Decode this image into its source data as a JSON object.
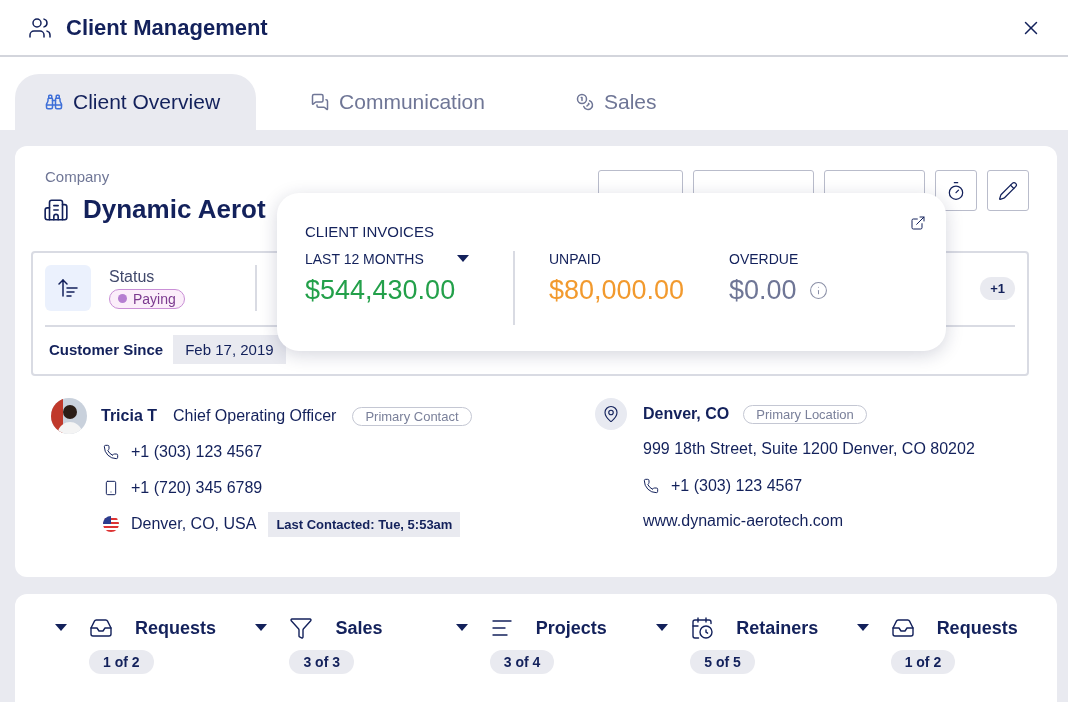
{
  "window": {
    "title": "Client Management"
  },
  "tabs": [
    {
      "label": "Client Overview",
      "selected": true
    },
    {
      "label": "Communication",
      "selected": false
    },
    {
      "label": "Sales",
      "selected": false
    }
  ],
  "company": {
    "label": "Company",
    "name": "Dynamic Aerot"
  },
  "summary": {
    "status_label": "Status",
    "status": {
      "label": "Paying",
      "color": "#b57fd1"
    },
    "more": "+1",
    "customer_since_label": "Customer Since",
    "customer_since": "Feb 17, 2019"
  },
  "invoices": {
    "title": "CLIENT INVOICES",
    "period": "LAST 12 MONTHS",
    "total": "$544,430.00",
    "unpaid_label": "UNPAID",
    "unpaid": "$80,000.00",
    "overdue_label": "OVERDUE",
    "overdue": "$0.00"
  },
  "contact": {
    "name": "Tricia T",
    "role": "Chief Operating Officer",
    "badge": "Primary Contact",
    "lines": [
      {
        "kind": "phone",
        "text": "+1 (303) 123 4567"
      },
      {
        "kind": "mobile",
        "text": "+1 (720) 345 6789"
      },
      {
        "kind": "flag",
        "text": "Denver, CO, USA",
        "note": "Last Contacted: Tue, 5:53am"
      }
    ]
  },
  "location": {
    "name": "Denver, CO",
    "badge": "Primary Location",
    "lines": [
      {
        "kind": "address",
        "text": "999 18th Street, Suite 1200 Denver, CO 80202"
      },
      {
        "kind": "phone",
        "text": "+1 (303) 123 4567"
      },
      {
        "kind": "web",
        "text": "www.dynamic-aerotech.com"
      }
    ]
  },
  "modules": [
    {
      "label": "Requests",
      "count": "1 of 2"
    },
    {
      "label": "Sales",
      "count": "3 of 3"
    },
    {
      "label": "Projects",
      "count": "3 of 4"
    },
    {
      "label": "Retainers",
      "count": "5 of 5"
    },
    {
      "label": "Requests",
      "count": "1 of 2"
    }
  ]
}
